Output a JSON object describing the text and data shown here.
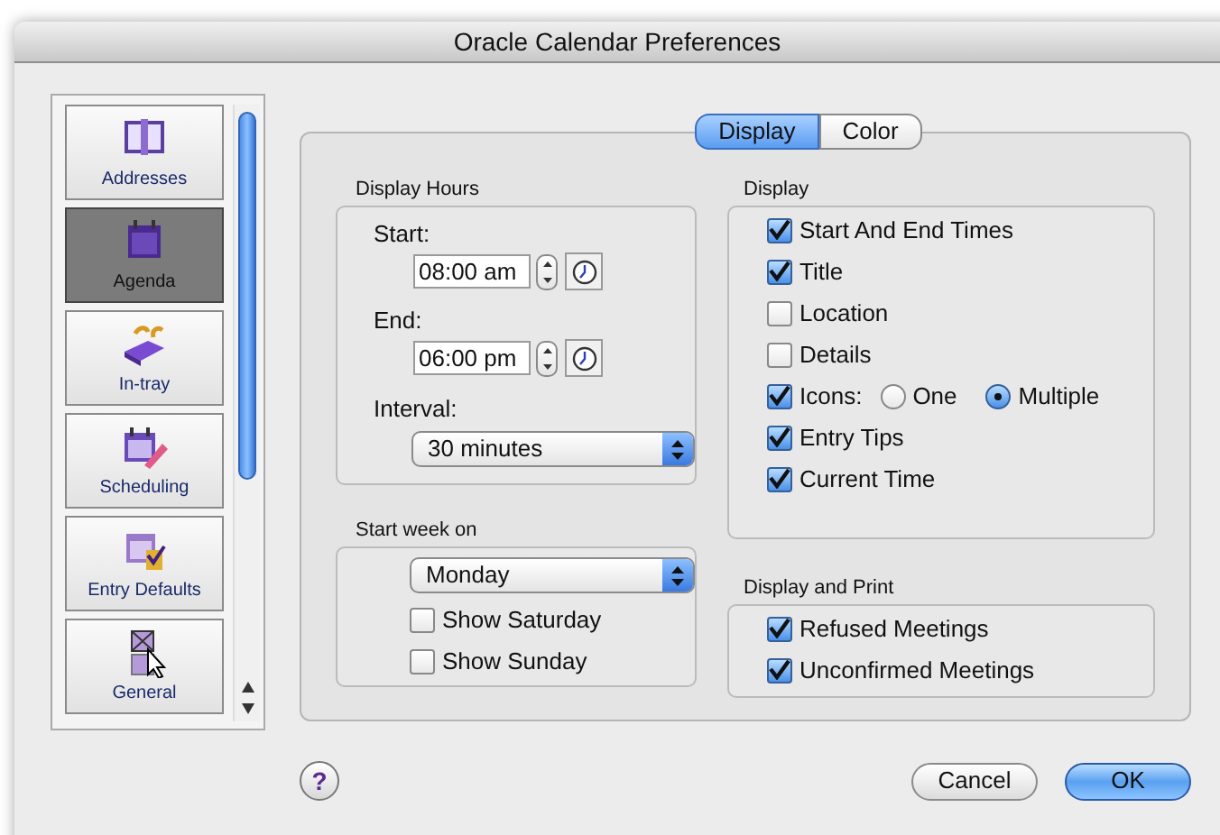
{
  "window": {
    "title": "Oracle Calendar Preferences"
  },
  "sidebar": {
    "items": [
      {
        "label": "Addresses",
        "selected": false
      },
      {
        "label": "Agenda",
        "selected": true
      },
      {
        "label": "In-tray",
        "selected": false
      },
      {
        "label": "Scheduling",
        "selected": false
      },
      {
        "label": "Entry Defaults",
        "selected": false
      },
      {
        "label": "General",
        "selected": false
      }
    ]
  },
  "tabs": [
    {
      "label": "Display",
      "selected": true
    },
    {
      "label": "Color",
      "selected": false
    }
  ],
  "display_hours": {
    "title": "Display Hours",
    "times": [
      {
        "label": "Start:",
        "value": "08:00 am"
      },
      {
        "label": "End:",
        "value": "06:00 pm"
      }
    ],
    "interval": {
      "label": "Interval:",
      "value": "30 minutes"
    }
  },
  "start_week": {
    "title": "Start week on",
    "value": "Monday",
    "options": [
      {
        "label": "Show Saturday",
        "checked": false
      },
      {
        "label": "Show Sunday",
        "checked": false
      }
    ]
  },
  "display": {
    "title": "Display",
    "options": [
      {
        "kind": "checkbox",
        "label": "Start And End Times",
        "checked": true
      },
      {
        "kind": "checkbox",
        "label": "Title",
        "checked": true
      },
      {
        "kind": "checkbox",
        "label": "Location",
        "checked": false
      },
      {
        "kind": "checkbox",
        "label": "Details",
        "checked": false
      },
      {
        "kind": "choice",
        "label": "Icons:",
        "checked": true,
        "choices": [
          {
            "label": "One",
            "selected": false
          },
          {
            "label": "Multiple",
            "selected": true
          }
        ]
      },
      {
        "kind": "checkbox",
        "label": "Entry Tips",
        "checked": true
      },
      {
        "kind": "checkbox",
        "label": "Current Time",
        "checked": true
      }
    ]
  },
  "display_print": {
    "title": "Display and Print",
    "options": [
      {
        "kind": "checkbox",
        "label": "Refused Meetings",
        "checked": true
      },
      {
        "kind": "checkbox",
        "label": "Unconfirmed Meetings",
        "checked": true
      }
    ]
  },
  "help_button": {
    "label": "?"
  },
  "buttons": [
    {
      "kind": "cancel",
      "label": "Cancel"
    },
    {
      "kind": "default",
      "label": "OK"
    }
  ]
}
